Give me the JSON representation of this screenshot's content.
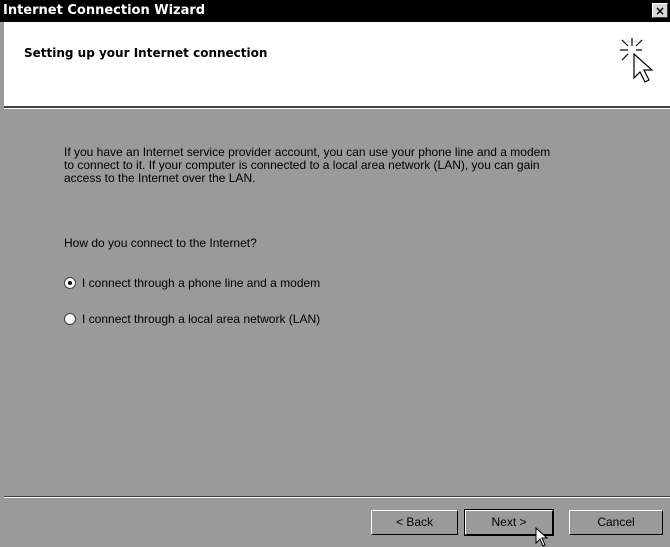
{
  "window": {
    "title": "Internet Connection Wizard",
    "close_glyph": "×"
  },
  "header": {
    "title": "Setting up your Internet connection",
    "icon": "wizard-cursor-sparkle-icon"
  },
  "body": {
    "description_lines": [
      "If you have an Internet service provider account, you can use your phone line and a modem",
      "to connect to it. If your computer is connected to a local area network (LAN), you can gain",
      "access to the Internet over the LAN."
    ],
    "question": "How do you connect to the Internet?",
    "options": [
      {
        "label": "I connect through a phone line and a modem",
        "checked": true
      },
      {
        "label": "I connect through a local area network (LAN)",
        "checked": false
      }
    ]
  },
  "buttons": {
    "back": "< Back",
    "next": "Next >",
    "cancel": "Cancel"
  }
}
